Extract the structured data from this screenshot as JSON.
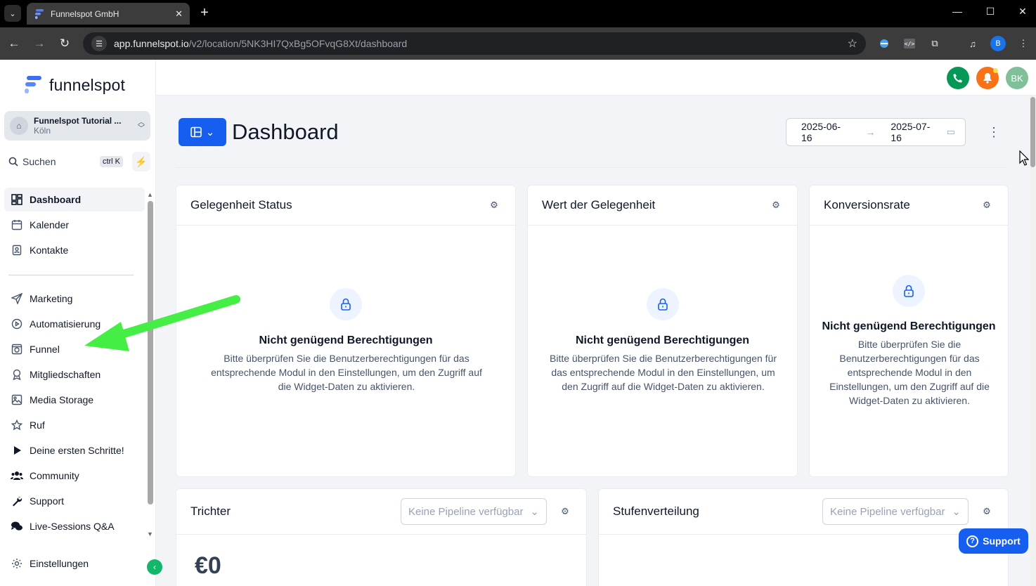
{
  "browser": {
    "tab_title": "Funnelspot GmbH",
    "url_host": "app.funnelspot.io",
    "url_path": "/v2/location/5NK3HI7QxBg5OFvqG8Xt/dashboard",
    "profile_initial": "B"
  },
  "sidebar": {
    "brand": "funnelspot",
    "location_name": "Funnelspot Tutorial ...",
    "location_city": "Köln",
    "search_placeholder": "Suchen",
    "search_shortcut": "ctrl K",
    "items": [
      {
        "label": "Dashboard",
        "icon": "dashboard-icon",
        "active": true
      },
      {
        "label": "Kalender",
        "icon": "calendar-icon"
      },
      {
        "label": "Kontakte",
        "icon": "contacts-icon"
      },
      {
        "label": "Marketing",
        "icon": "send-icon"
      },
      {
        "label": "Automatisierung",
        "icon": "automation-icon"
      },
      {
        "label": "Funnel",
        "icon": "funnel-icon"
      },
      {
        "label": "Mitgliedschaften",
        "icon": "badge-icon"
      },
      {
        "label": "Media Storage",
        "icon": "image-icon"
      },
      {
        "label": "Ruf",
        "icon": "star-icon"
      },
      {
        "label": "Deine ersten Schritte!",
        "icon": "play-icon"
      },
      {
        "label": "Community",
        "icon": "people-icon"
      },
      {
        "label": "Support",
        "icon": "wrench-icon"
      },
      {
        "label": "Live-Sessions Q&A",
        "icon": "chat-icon"
      }
    ],
    "settings_label": "Einstellungen"
  },
  "topbar": {
    "avatar_initials": "BK"
  },
  "dashboard": {
    "title": "Dashboard",
    "date_from": "2025-06-16",
    "date_to": "2025-07-16"
  },
  "cards": {
    "opportunity_status": {
      "title": "Gelegenheit Status",
      "perm_title": "Nicht genügend Berechtigungen",
      "perm_text": "Bitte überprüfen Sie die Benutzerberechtigungen für das entsprechende Modul in den Einstellungen, um den Zugriff auf die Widget-Daten zu aktivieren."
    },
    "opportunity_value": {
      "title": "Wert der Gelegenheit",
      "perm_title": "Nicht genügend Berechtigungen",
      "perm_text": "Bitte überprüfen Sie die Benutzerberechtigungen für das entsprechende Modul in den Einstellungen, um den Zugriff auf die Widget-Daten zu aktivieren."
    },
    "conversion_rate": {
      "title": "Konversionsrate",
      "perm_title": "Nicht genügend Berechtigungen",
      "perm_text": "Bitte überprüfen Sie die Benutzerberechtigungen für das entsprechende Modul in den Einstellungen, um den Zugriff auf die Widget-Daten zu aktivieren."
    },
    "funnel": {
      "title": "Trichter",
      "pipeline_placeholder": "Keine Pipeline verfügbar",
      "value": "€0"
    },
    "stage_distribution": {
      "title": "Stufenverteilung",
      "pipeline_placeholder": "Keine Pipeline verfügbar"
    }
  },
  "support_button": "Support",
  "colors": {
    "primary": "#155eef",
    "accent_green": "#12b76a",
    "notification_orange": "#f97316",
    "phone_green": "#039855",
    "avatar_green": "#7fbf9a",
    "annotation_arrow": "#44ee44"
  }
}
